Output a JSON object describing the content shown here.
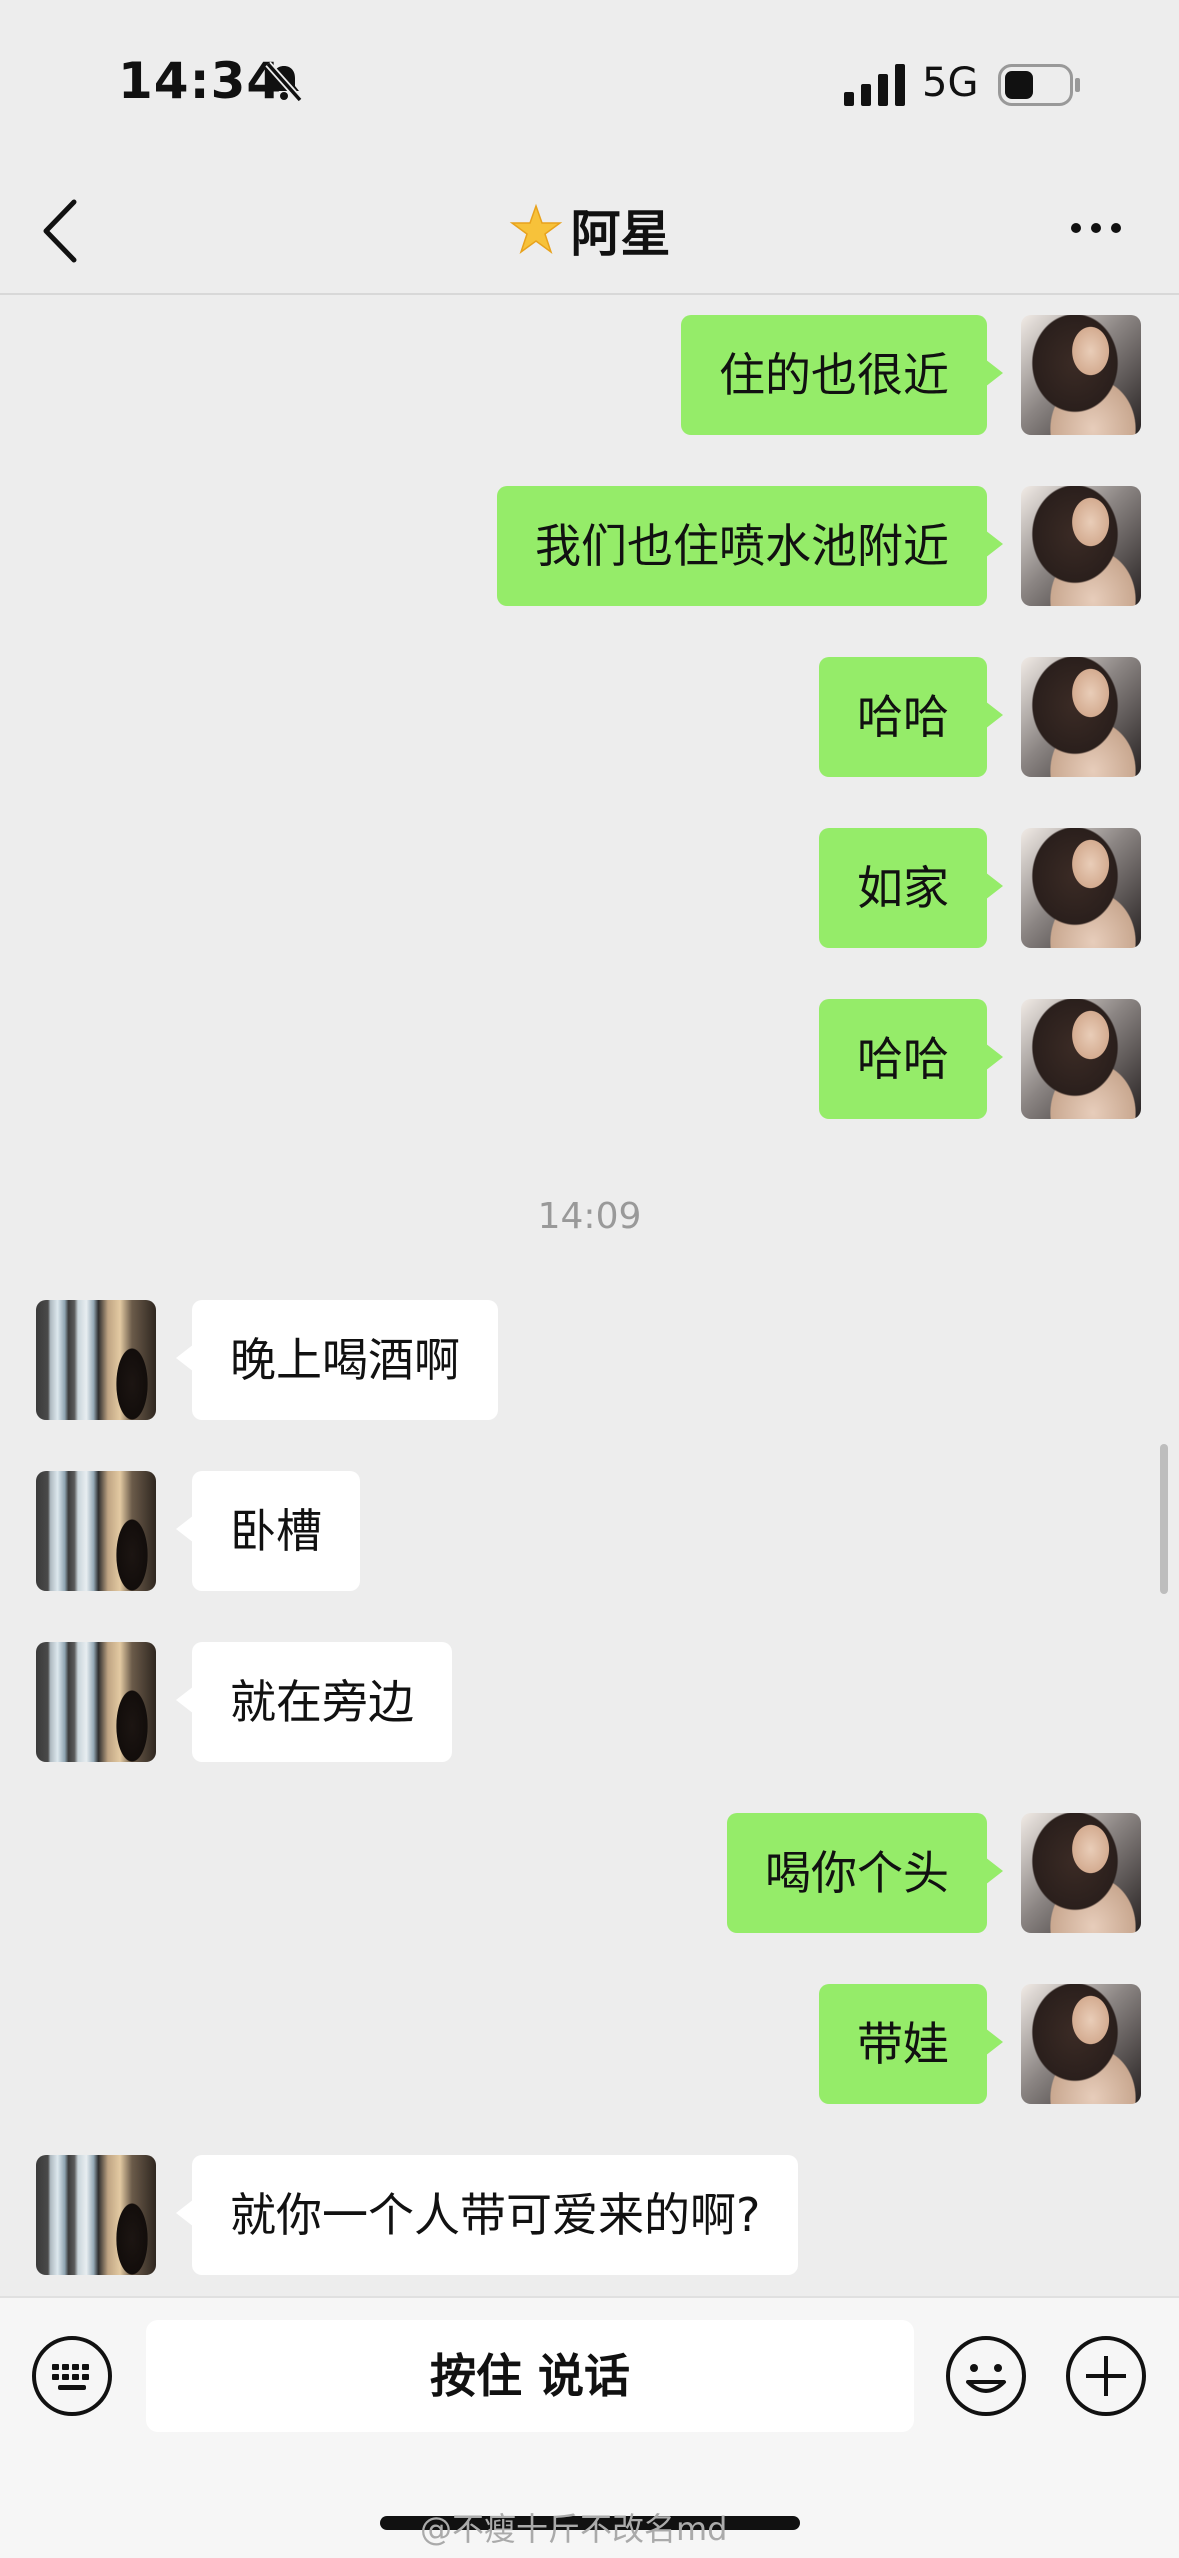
{
  "status": {
    "time": "14:34",
    "network": "5G"
  },
  "nav": {
    "title": "阿星"
  },
  "messages": [
    {
      "side": "sent",
      "text": "住的也很近"
    },
    {
      "side": "sent",
      "text": "我们也住喷水池附近"
    },
    {
      "side": "sent",
      "text": "哈哈"
    },
    {
      "side": "sent",
      "text": "如家"
    },
    {
      "side": "sent",
      "text": "哈哈"
    },
    {
      "side": "recv",
      "text": "晚上喝酒啊"
    },
    {
      "side": "recv",
      "text": "卧槽"
    },
    {
      "side": "recv",
      "text": "就在旁边"
    },
    {
      "side": "sent",
      "text": "喝你个头"
    },
    {
      "side": "sent",
      "text": "带娃"
    },
    {
      "side": "recv",
      "text": "就你一个人带可爱来的啊?"
    }
  ],
  "timestamp": "14:09",
  "input": {
    "hold_to_talk": "按住 说话"
  },
  "watermark": "@不瘦十斤不改名md",
  "colors": {
    "sent_bubble": "#95ec69",
    "recv_bubble": "#ffffff",
    "background": "#ededed"
  },
  "icons": {
    "status": [
      "bell-slash-icon",
      "signal-icon",
      "battery-icon"
    ],
    "nav": [
      "back-chevron-icon",
      "star-icon",
      "more-icon"
    ],
    "input": [
      "keyboard-icon",
      "emoji-icon",
      "plus-icon"
    ]
  }
}
